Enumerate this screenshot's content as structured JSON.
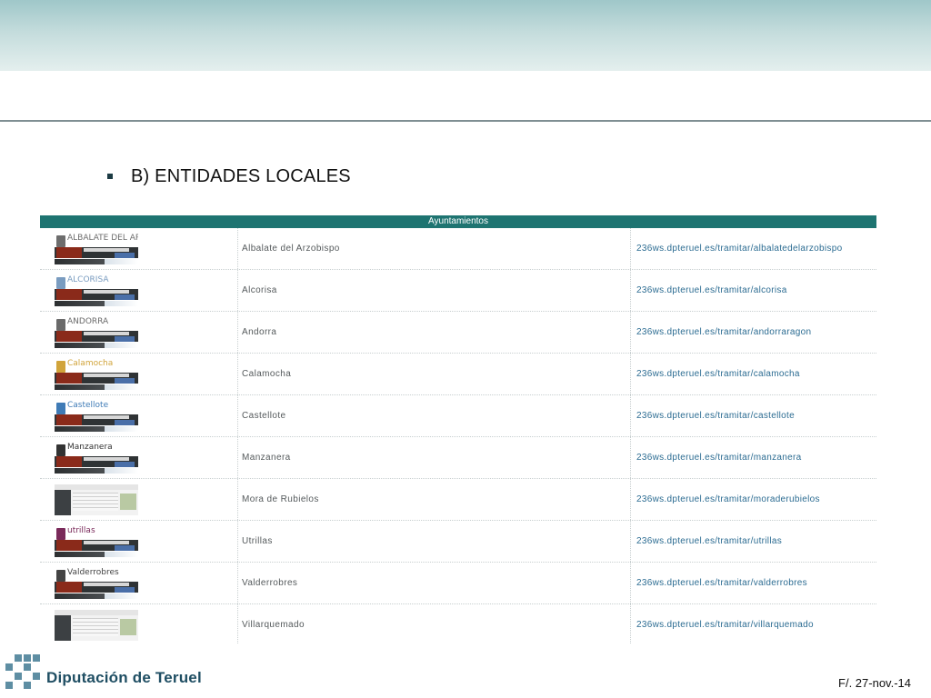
{
  "slide": {
    "heading": "B) ENTIDADES LOCALES",
    "footer_brand": "Diputación de Teruel",
    "footer_date": "F/. 27-nov.-14"
  },
  "table": {
    "title": "Ayuntamientos",
    "rows": [
      {
        "name": "Albalate del Arzobispo",
        "url": "236ws.dpteruel.es/tramitar/albalatedelarzobispo",
        "thumb_label": "ALBALATE DEL ARZOBISPO",
        "thumb_color": "#6d6d6d",
        "thumb_style": "bar"
      },
      {
        "name": "Alcorisa",
        "url": "236ws.dpteruel.es/tramitar/alcorisa",
        "thumb_label": "ALCORISA",
        "thumb_color": "#7a9cc0",
        "thumb_style": "bar"
      },
      {
        "name": "Andorra",
        "url": "236ws.dpteruel.es/tramitar/andorraragon",
        "thumb_label": "ANDORRA",
        "thumb_color": "#6a6a6a",
        "thumb_style": "bar"
      },
      {
        "name": "Calamocha",
        "url": "236ws.dpteruel.es/tramitar/calamocha",
        "thumb_label": "Calamocha",
        "thumb_color": "#d1a43a",
        "thumb_style": "bar"
      },
      {
        "name": "Castellote",
        "url": "236ws.dpteruel.es/tramitar/castellote",
        "thumb_label": "Castellote",
        "thumb_color": "#3f7bb6",
        "thumb_style": "bar"
      },
      {
        "name": "Manzanera",
        "url": "236ws.dpteruel.es/tramitar/manzanera",
        "thumb_label": "Manzanera",
        "thumb_color": "#333333",
        "thumb_style": "bar"
      },
      {
        "name": "Mora de Rubielos",
        "url": "236ws.dpteruel.es/tramitar/moraderubielos",
        "thumb_label": "",
        "thumb_color": "#8a8a8a",
        "thumb_style": "page"
      },
      {
        "name": "Utrillas",
        "url": "236ws.dpteruel.es/tramitar/utrillas",
        "thumb_label": "utrillas",
        "thumb_color": "#7a2a5a",
        "thumb_style": "bar"
      },
      {
        "name": "Valderrobres",
        "url": "236ws.dpteruel.es/tramitar/valderrobres",
        "thumb_label": "Valderrobres",
        "thumb_color": "#444444",
        "thumb_style": "bar"
      },
      {
        "name": "Villarquemado",
        "url": "236ws.dpteruel.es/tramitar/villarquemado",
        "thumb_label": "",
        "thumb_color": "#8a8a8a",
        "thumb_style": "page"
      }
    ]
  }
}
